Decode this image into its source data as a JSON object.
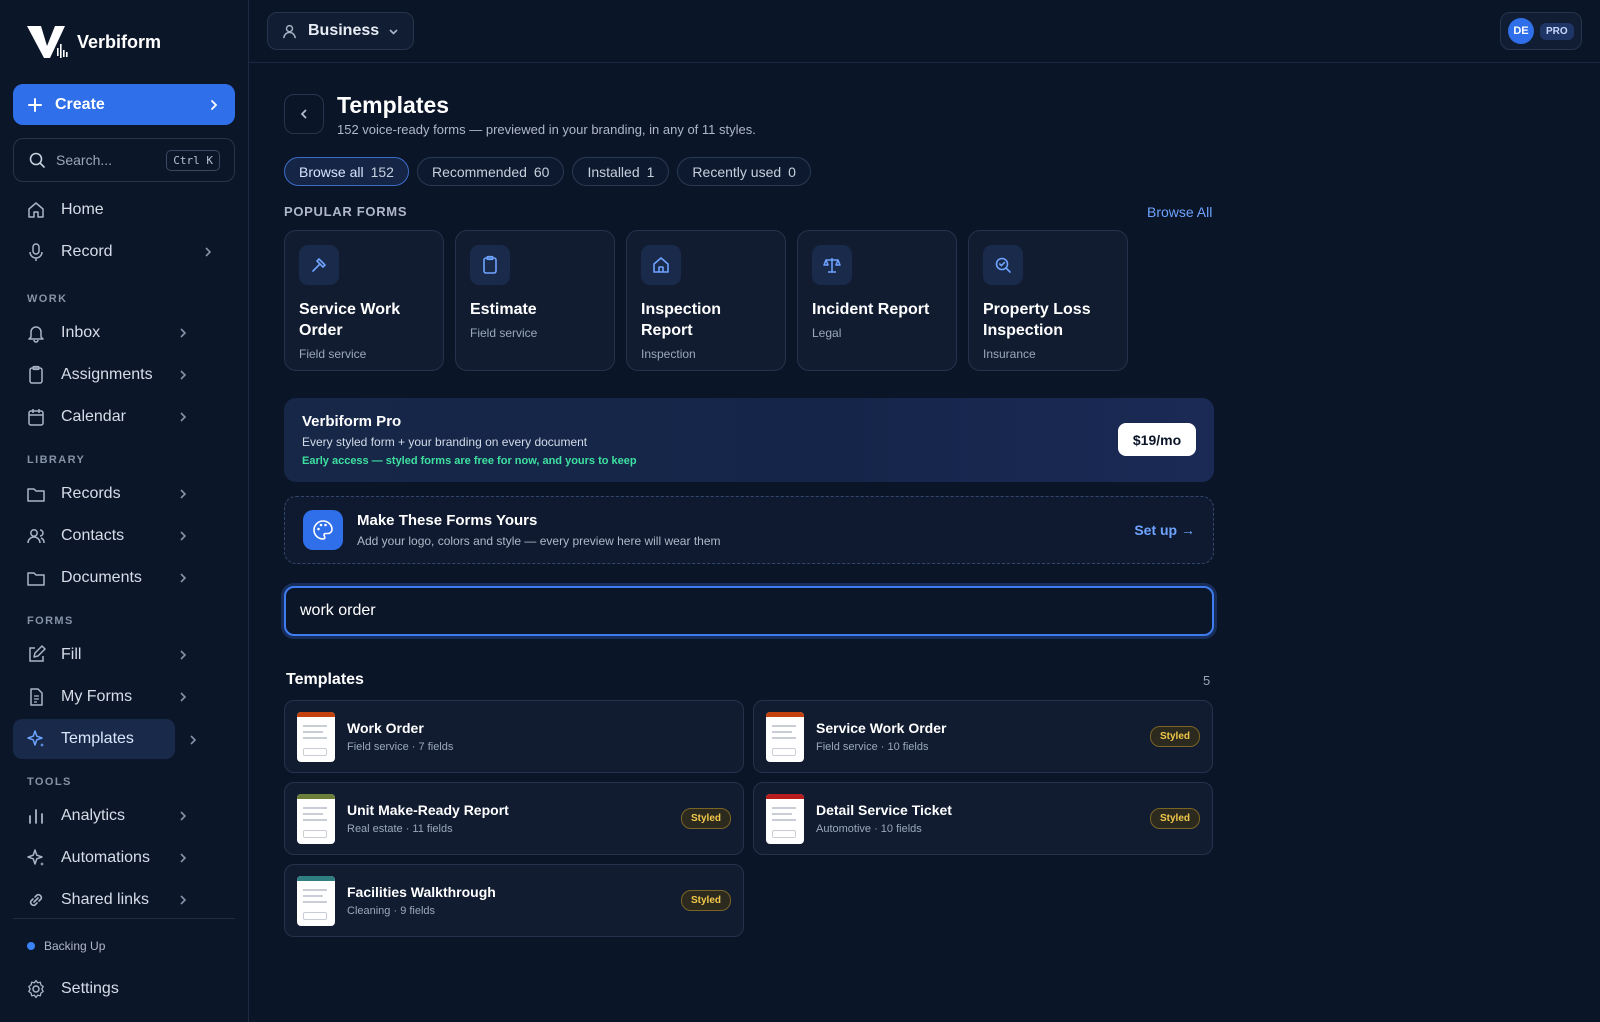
{
  "app": {
    "name": "Verbiform"
  },
  "sidebar": {
    "create_label": "Create",
    "search_placeholder": "Search...",
    "search_shortcut": "Ctrl K",
    "top_items": [
      {
        "label": "Home",
        "icon": "home-icon"
      },
      {
        "label": "Record",
        "icon": "mic-icon"
      }
    ],
    "sections": {
      "work": "WORK",
      "library": "LIBRARY",
      "forms": "FORMS",
      "tools": "TOOLS"
    },
    "work_items": [
      {
        "label": "Inbox",
        "icon": "bell-icon"
      },
      {
        "label": "Assignments",
        "icon": "clipboard-icon"
      },
      {
        "label": "Calendar",
        "icon": "calendar-icon"
      }
    ],
    "library_items": [
      {
        "label": "Records",
        "icon": "folder-icon"
      },
      {
        "label": "Contacts",
        "icon": "users-icon"
      },
      {
        "label": "Documents",
        "icon": "folder-icon"
      }
    ],
    "forms_items": [
      {
        "label": "Fill",
        "icon": "edit-icon"
      },
      {
        "label": "My Forms",
        "icon": "file-icon"
      },
      {
        "label": "Templates",
        "icon": "sparkle-icon",
        "active": true
      }
    ],
    "tools_items": [
      {
        "label": "Analytics",
        "icon": "bar-chart-icon"
      },
      {
        "label": "Automations",
        "icon": "sparkle-icon"
      },
      {
        "label": "Shared links",
        "icon": "link-icon"
      }
    ],
    "status": "Backing Up",
    "settings_label": "Settings"
  },
  "topbar": {
    "org": "Business",
    "avatar_initials": "DE",
    "plan_badge": "PRO"
  },
  "page": {
    "title": "Templates",
    "subtitle": "152 voice-ready forms — previewed in your branding, in any of 11 styles."
  },
  "tabs": [
    {
      "label": "Browse all",
      "count": "152",
      "active": true
    },
    {
      "label": "Recommended",
      "count": "60"
    },
    {
      "label": "Installed",
      "count": "1"
    },
    {
      "label": "Recently used",
      "count": "0"
    }
  ],
  "popular": {
    "label": "POPULAR FORMS",
    "browse_all": "Browse All",
    "cards": [
      {
        "name": "Service Work Order",
        "category": "Field service",
        "icon": "hammer-icon"
      },
      {
        "name": "Estimate",
        "category": "Field service",
        "icon": "clipboard-icon"
      },
      {
        "name": "Inspection Report",
        "category": "Inspection",
        "icon": "house-icon"
      },
      {
        "name": "Incident Report",
        "category": "Legal",
        "icon": "scale-icon"
      },
      {
        "name": "Property Loss Inspection",
        "category": "Insurance",
        "icon": "magnify-check-icon"
      }
    ]
  },
  "pro_banner": {
    "title": "Verbiform Pro",
    "description": "Every styled form + your branding on every document",
    "note": "Early access — styled forms are free for now, and yours to keep",
    "price": "$19/mo",
    "note_color": "#3ee0a0"
  },
  "branding": {
    "title": "Make These Forms Yours",
    "description": "Add your logo, colors and style — every preview here will wear them",
    "action": "Set up →"
  },
  "filter": {
    "value": "work order"
  },
  "results": {
    "label": "Templates",
    "count": "5",
    "items": [
      {
        "name": "Work Order",
        "meta": "Field service · 7 fields",
        "styled": "",
        "accent": "#c2410c"
      },
      {
        "name": "Service Work Order",
        "meta": "Field service · 10 fields",
        "styled": "Styled",
        "accent": "#c2410c"
      },
      {
        "name": "Unit Make-Ready Report",
        "meta": "Real estate · 11 fields",
        "styled": "Styled",
        "accent": "#6b7f3a"
      },
      {
        "name": "Detail Service Ticket",
        "meta": "Automotive · 10 fields",
        "styled": "Styled",
        "accent": "#b91c1c"
      },
      {
        "name": "Facilities Walkthrough",
        "meta": "Cleaning · 9 fields",
        "styled": "Styled",
        "accent": "#2f7f80"
      }
    ]
  },
  "colors": {
    "accent": "#2f6fea",
    "background": "#0b1528",
    "badge": "#f1c84b"
  }
}
